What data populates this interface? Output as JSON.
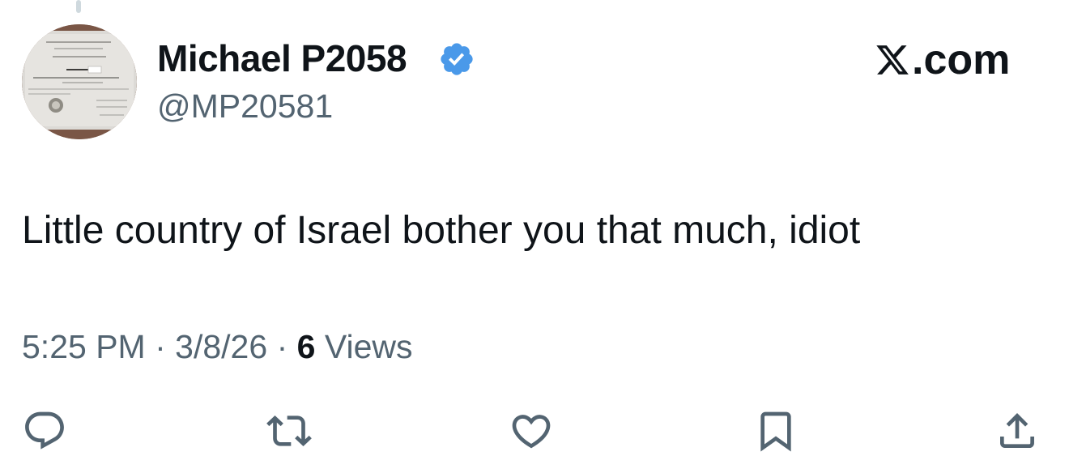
{
  "author": {
    "display_name": "Michael P2058",
    "handle": "@MP20581",
    "verified": true,
    "verified_color": "#4a99e9",
    "avatar": "certificate-photo"
  },
  "brand": {
    "label": ".com",
    "logo": "x-logo"
  },
  "tweet": {
    "text": "Little country of Israel bother you that much, idiot"
  },
  "meta": {
    "time": "5:25 PM",
    "separator": "·",
    "date": "3/8/26",
    "views_count": "6",
    "views_label": "Views"
  },
  "actions": [
    {
      "name": "reply",
      "icon": "reply-icon"
    },
    {
      "name": "repost",
      "icon": "repost-icon"
    },
    {
      "name": "like",
      "icon": "heart-icon"
    },
    {
      "name": "bookmark",
      "icon": "bookmark-icon"
    },
    {
      "name": "share",
      "icon": "share-icon"
    }
  ],
  "colors": {
    "text": "#0f1419",
    "secondary_text": "#536471",
    "background": "#ffffff"
  }
}
